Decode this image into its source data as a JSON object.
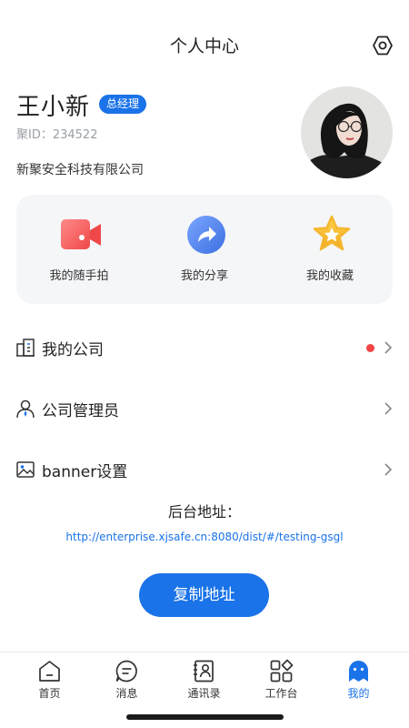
{
  "header": {
    "title": "个人中心",
    "settings_icon": "hexagon-gear-icon"
  },
  "profile": {
    "name": "王小新",
    "role": "总经理",
    "id_text": "聚ID：234522",
    "company": "新聚安全科技有限公司"
  },
  "quick_actions": [
    {
      "label": "我的随手拍",
      "icon": "video-camera-icon",
      "color": "#f25c5c"
    },
    {
      "label": "我的分享",
      "icon": "share-arrow-icon",
      "color": "#4f86ee"
    },
    {
      "label": "我的收藏",
      "icon": "star-icon",
      "color": "#f5b731"
    }
  ],
  "menu": [
    {
      "label": "我的公司",
      "icon": "building-icon",
      "has_badge": true
    },
    {
      "label": "公司管理员",
      "icon": "admin-person-icon",
      "has_badge": false
    },
    {
      "label": "banner设置",
      "icon": "image-icon",
      "has_badge": false
    }
  ],
  "backend": {
    "label": "后台地址：",
    "url": "http://enterprise.xjsafe.cn:8080/dist/#/testing-gsgl",
    "copy_button": "复制地址"
  },
  "tabbar": [
    {
      "label": "首页",
      "icon": "home-icon",
      "active": false
    },
    {
      "label": "消息",
      "icon": "message-icon",
      "active": false
    },
    {
      "label": "通讯录",
      "icon": "contacts-icon",
      "active": false
    },
    {
      "label": "工作台",
      "icon": "workbench-icon",
      "active": false
    },
    {
      "label": "我的",
      "icon": "profile-icon",
      "active": true
    }
  ],
  "colors": {
    "accent": "#1a73e8",
    "badge_red": "#f04545",
    "card_bg": "#f5f6f8"
  }
}
